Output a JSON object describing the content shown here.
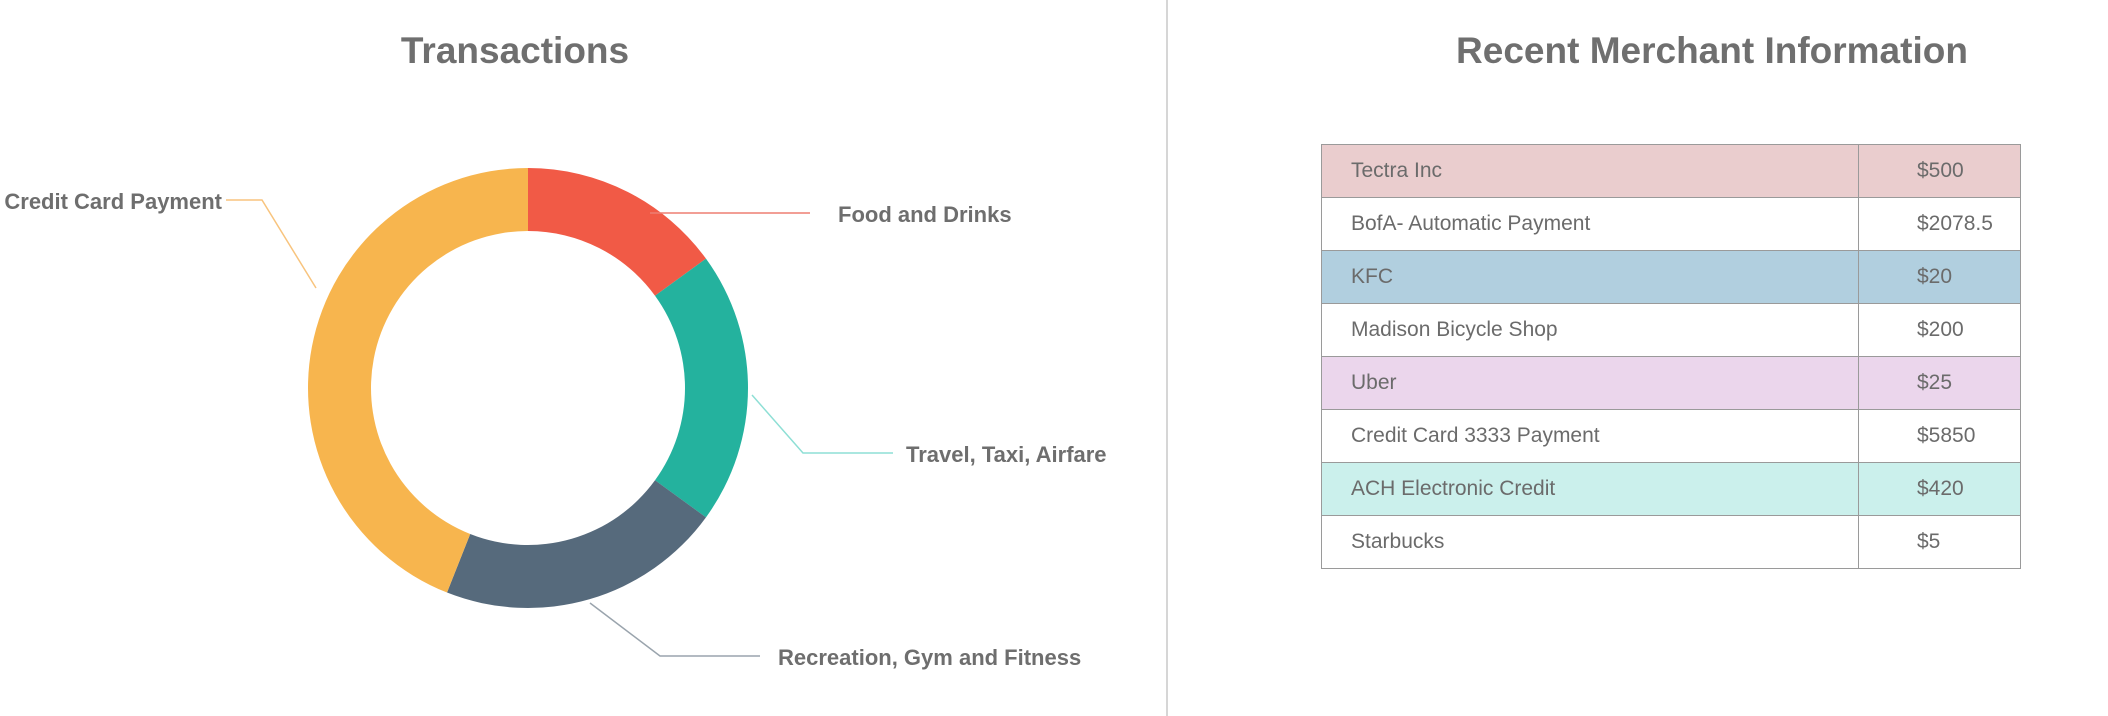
{
  "left_panel": {
    "title": "Transactions"
  },
  "right_panel": {
    "title": "Recent Merchant Information"
  },
  "chart_data": {
    "type": "pie",
    "variant": "donut",
    "title": "Transactions",
    "categories": [
      "Food and Drinks",
      "Travel, Taxi, Airfare",
      "Recreation, Gym and Fitness",
      "Credit Card Payment"
    ],
    "values": [
      15,
      20,
      21,
      44
    ],
    "colors": [
      "#f15a46",
      "#24b29e",
      "#566a7c",
      "#f7b54e"
    ],
    "leader_colors": [
      "#ee7e72",
      "#8edfd5",
      "#9aa4ad",
      "#f8c47e"
    ]
  },
  "merchants": {
    "rows": [
      {
        "name": "Tectra Inc",
        "amount": "$500",
        "bg": "#eacdce"
      },
      {
        "name": "BofA- Automatic Payment",
        "amount": "$2078.5",
        "bg": "#ffffff"
      },
      {
        "name": "KFC",
        "amount": "$20",
        "bg": "#b1cfdf"
      },
      {
        "name": "Madison Bicycle Shop",
        "amount": "$200",
        "bg": "#ffffff"
      },
      {
        "name": "Uber",
        "amount": "$25",
        "bg": "#ebd6ec"
      },
      {
        "name": "Credit Card 3333 Payment",
        "amount": "$5850",
        "bg": "#ffffff"
      },
      {
        "name": "ACH Electronic Credit",
        "amount": "$420",
        "bg": "#cbf0ec"
      },
      {
        "name": "Starbucks",
        "amount": "$5",
        "bg": "#ffffff"
      }
    ]
  }
}
